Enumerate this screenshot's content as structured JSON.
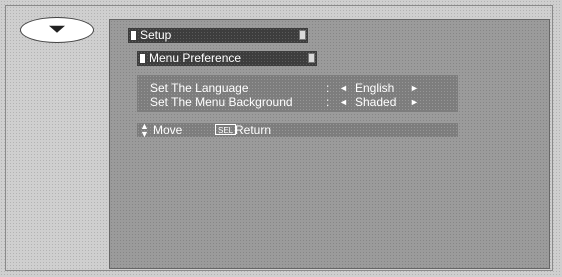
{
  "nav": {
    "icon": "chevron-down-icon"
  },
  "setup": {
    "title": "Setup"
  },
  "menu_preference": {
    "title": "Menu Preference"
  },
  "options": [
    {
      "label": "Set The Language",
      "separator": ":",
      "value": "English"
    },
    {
      "label": "Set The Menu Background",
      "separator": ":",
      "value": "Shaded"
    }
  ],
  "footer": {
    "move_label": "Move",
    "sel_icon_text": "SEL",
    "return_label": "Return"
  },
  "glyphs": {
    "left": "◄",
    "right": "►",
    "updown": "▲▼",
    "end": "▲"
  }
}
